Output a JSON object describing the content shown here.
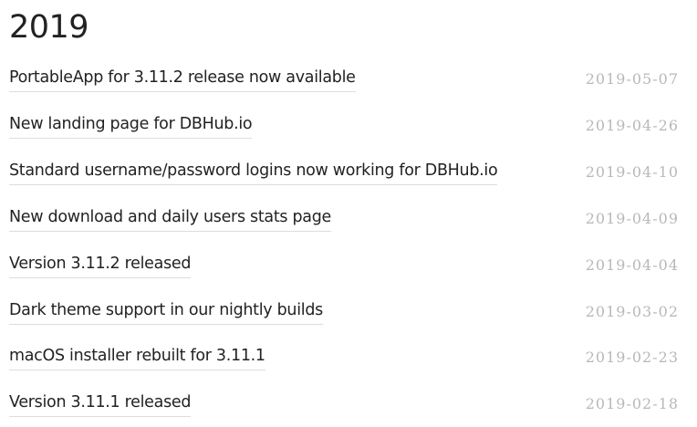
{
  "year": "2019",
  "posts": [
    {
      "title": "PortableApp for 3.11.2 release now available",
      "date": "2019-05-07"
    },
    {
      "title": "New landing page for DBHub.io",
      "date": "2019-04-26"
    },
    {
      "title": "Standard username/password logins now working for DBHub.io",
      "date": "2019-04-10"
    },
    {
      "title": "New download and daily users stats page",
      "date": "2019-04-09"
    },
    {
      "title": "Version 3.11.2 released",
      "date": "2019-04-04"
    },
    {
      "title": "Dark theme support in our nightly builds",
      "date": "2019-03-02"
    },
    {
      "title": "macOS installer rebuilt for 3.11.1",
      "date": "2019-02-23"
    },
    {
      "title": "Version 3.11.1 released",
      "date": "2019-02-18"
    }
  ]
}
